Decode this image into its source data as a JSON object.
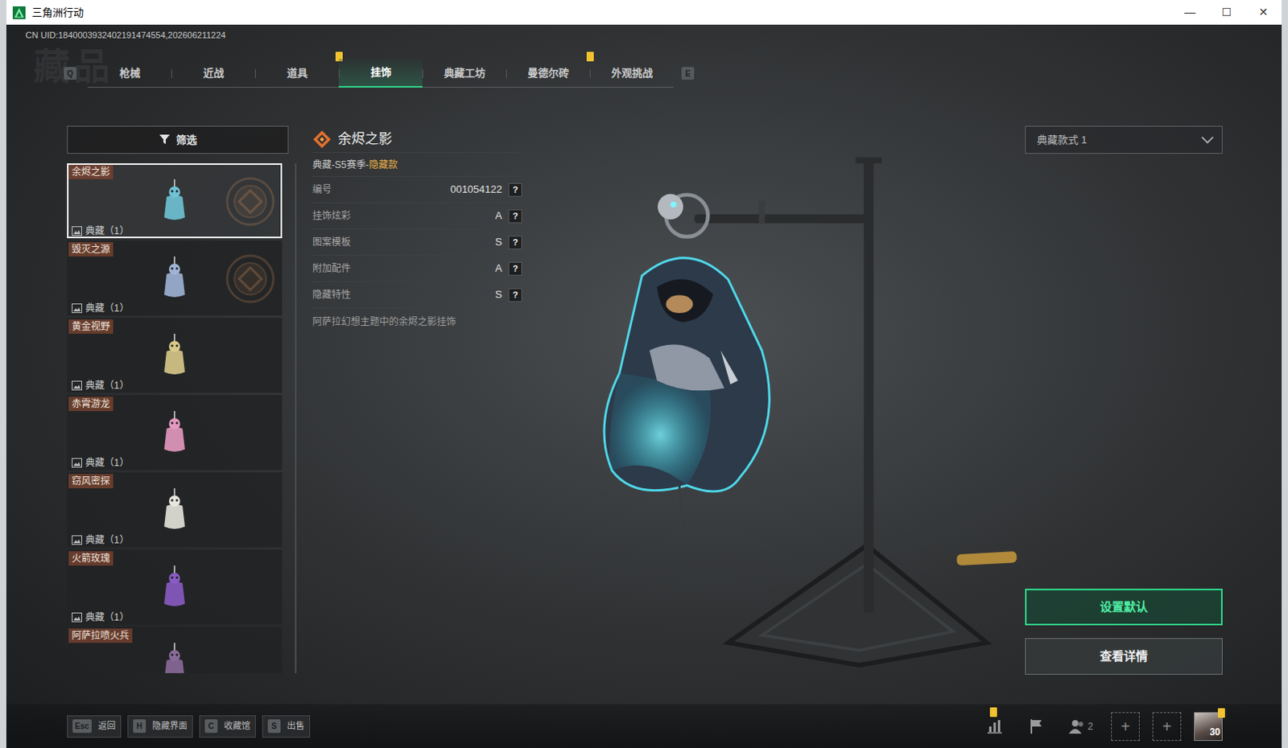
{
  "window": {
    "title": "三角洲行动",
    "controls": [
      "—",
      "☐",
      "✕"
    ]
  },
  "uid": "CN UID:1840003932402191474554,202606211224",
  "watermark": "藏品",
  "tabs": {
    "prev_key": "Q",
    "next_key": "E",
    "items": [
      {
        "label": "枪械",
        "selected": false,
        "notify": false
      },
      {
        "label": "近战",
        "selected": false,
        "notify": false
      },
      {
        "label": "道具",
        "selected": false,
        "notify": true
      },
      {
        "label": "挂饰",
        "selected": true,
        "notify": false
      },
      {
        "label": "典藏工坊",
        "selected": false,
        "notify": false
      },
      {
        "label": "曼德尔砖",
        "selected": false,
        "notify": true
      },
      {
        "label": "外观挑战",
        "selected": false,
        "notify": false
      }
    ]
  },
  "filter": {
    "label": "筛选"
  },
  "items": [
    {
      "name": "余烬之影",
      "tag": "典藏（1）",
      "selected": true,
      "emblem": true,
      "color": "#6fc3d6"
    },
    {
      "name": "毁灭之源",
      "tag": "典藏（1）",
      "selected": false,
      "emblem": true,
      "color": "#9fb4d6"
    },
    {
      "name": "黄金视野",
      "tag": "典藏（1）",
      "selected": false,
      "emblem": false,
      "color": "#d8c98a"
    },
    {
      "name": "赤霄游龙",
      "tag": "典藏（1）",
      "selected": false,
      "emblem": false,
      "color": "#e59ac0"
    },
    {
      "name": "窃风密探",
      "tag": "典藏（1）",
      "selected": false,
      "emblem": false,
      "color": "#e6e6de"
    },
    {
      "name": "火箭玫瑰",
      "tag": "典藏（1）",
      "selected": false,
      "emblem": false,
      "color": "#8a5bc4"
    },
    {
      "name": "阿萨拉喷火兵",
      "tag": "",
      "selected": false,
      "emblem": false,
      "color": "#8a6a9a"
    }
  ],
  "detail": {
    "title": "余烬之影",
    "series": "典藏-S5赛季-",
    "series_highlight": "隐藏款",
    "stats": [
      {
        "label": "编号",
        "value": "001054122",
        "help": "?"
      },
      {
        "label": "挂饰炫彩",
        "value": "A",
        "help": "?"
      },
      {
        "label": "图案模板",
        "value": "S",
        "help": "?"
      },
      {
        "label": "附加配件",
        "value": "A",
        "help": "?"
      },
      {
        "label": "隐藏特性",
        "value": "S",
        "help": "?"
      }
    ],
    "description": "阿萨拉幻想主题中的余烬之影挂饰"
  },
  "style_select": {
    "value": "典藏款式 1"
  },
  "buttons": [
    {
      "label": "设置默认",
      "primary": true
    },
    {
      "label": "查看详情",
      "primary": false
    }
  ],
  "hotkeys": [
    {
      "key": "Esc",
      "label": "返回"
    },
    {
      "key": "H",
      "label": "隐藏界面"
    },
    {
      "key": "C",
      "label": "收藏馆"
    },
    {
      "key": "S",
      "label": "出售"
    }
  ],
  "tray": [
    {
      "kind": "chart",
      "text": "",
      "notify": true
    },
    {
      "kind": "flag",
      "text": "",
      "notify": false
    },
    {
      "kind": "friends",
      "text": "2",
      "notify": false
    },
    {
      "kind": "add",
      "text": "+",
      "notify": false
    },
    {
      "kind": "add",
      "text": "+",
      "notify": false
    },
    {
      "kind": "avatar",
      "text": "30",
      "notify": true
    }
  ]
}
